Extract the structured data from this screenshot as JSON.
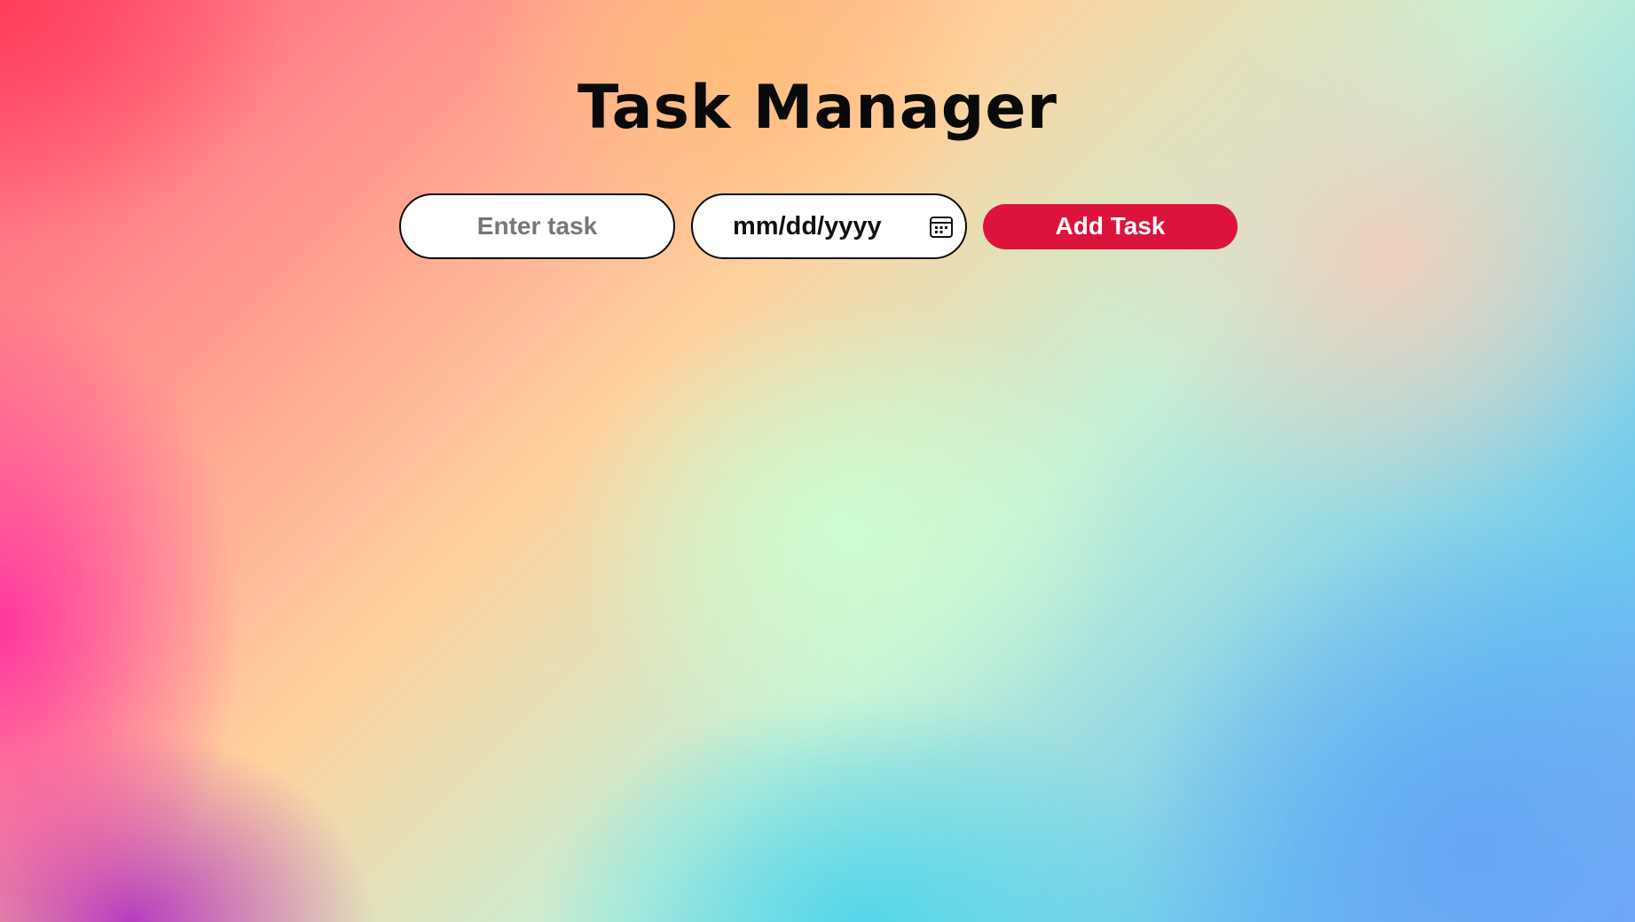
{
  "app": {
    "title": "Task Manager"
  },
  "form": {
    "task_input": {
      "placeholder": "Enter task",
      "value": ""
    },
    "date_input": {
      "placeholder": "mm/dd/yyyy",
      "value": "",
      "icon": "calendar-icon"
    },
    "add_button_label": "Add Task"
  },
  "colors": {
    "accent": "#dc143c",
    "title_text": "#0a0a0a",
    "field_border": "#0a0a0a",
    "field_background": "#ffffff",
    "placeholder_text": "#777777"
  }
}
